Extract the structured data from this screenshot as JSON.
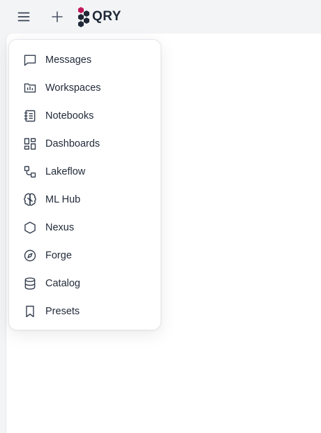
{
  "header": {
    "menu_icon": "hamburger-menu-icon",
    "new_icon": "plus-icon",
    "logo_text": "QRY",
    "logo_colors": {
      "accent": "#c2185b",
      "dark": "#1f2937"
    }
  },
  "menu": {
    "items": [
      {
        "label": "Messages",
        "icon": "message-square-icon"
      },
      {
        "label": "Workspaces",
        "icon": "folder-chart-icon"
      },
      {
        "label": "Notebooks",
        "icon": "notebook-icon"
      },
      {
        "label": "Dashboards",
        "icon": "dashboard-grid-icon"
      },
      {
        "label": "Lakeflow",
        "icon": "workflow-icon"
      },
      {
        "label": "ML Hub",
        "icon": "brain-icon"
      },
      {
        "label": "Nexus",
        "icon": "hexagon-icon"
      },
      {
        "label": "Forge",
        "icon": "compass-icon"
      },
      {
        "label": "Catalog",
        "icon": "database-icon"
      },
      {
        "label": "Presets",
        "icon": "bookmark-icon"
      }
    ]
  }
}
